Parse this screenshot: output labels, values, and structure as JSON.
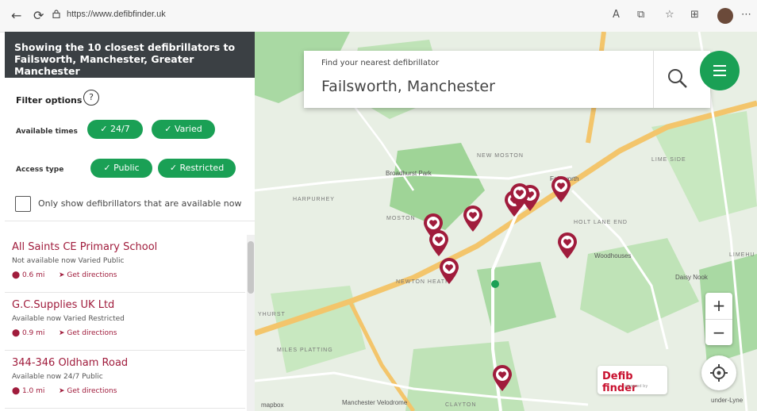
{
  "browser": {
    "url": "https://www.defibfinder.uk",
    "back_glyph": "←",
    "refresh_glyph": "⟳"
  },
  "sidebar": {
    "header": "Showing the 10 closest defibrillators to Failsworth, Manchester, Greater Manchester",
    "filter_title": "Filter options",
    "help_glyph": "?",
    "available_times_label": "Available times",
    "times_options": [
      "✓ 24/7",
      "✓ Varied"
    ],
    "access_type_label": "Access type",
    "access_options": [
      "✓ Public",
      "✓ Restricted"
    ],
    "only_available_label": "Only show defibrillators that are available now",
    "only_available_checked": false,
    "items": [
      {
        "name": "All Saints CE Primary School",
        "status": "Not available now  Varied  Public",
        "distance": "0.6 mi",
        "directions": "Get directions"
      },
      {
        "name": "G.C.Supplies UK Ltd",
        "status": "Available now  Varied  Restricted",
        "distance": "0.9 mi",
        "directions": "Get directions"
      },
      {
        "name": "344-346 Oldham Road",
        "status": "Available now  24/7  Public",
        "distance": "1.0 mi",
        "directions": "Get directions"
      }
    ]
  },
  "search": {
    "caption": "Find your nearest defibrillator",
    "value": "Failsworth, Manchester"
  },
  "map": {
    "labels": [
      "Failsworth",
      "NEW MOSTON",
      "Broadhurst Park",
      "MOSTON",
      "HARPURHEY",
      "NEWTON HEATH",
      "Woodhouses",
      "HOLT LANE END",
      "LIME SIDE",
      "Daisy Nook",
      "MILES PLATTING",
      "Manchester Velodrome",
      "CLAYTON",
      "under-Lyne",
      "LIMEHU",
      "YHURST"
    ],
    "zoom_in": "+",
    "zoom_out": "−",
    "logo_text": "Defib finder",
    "logo_sub": "powered by",
    "attribution": "mapbox"
  },
  "colors": {
    "accent_green": "#1aa055",
    "pin_red": "#a01c3c",
    "header_dark": "#3b4044"
  }
}
